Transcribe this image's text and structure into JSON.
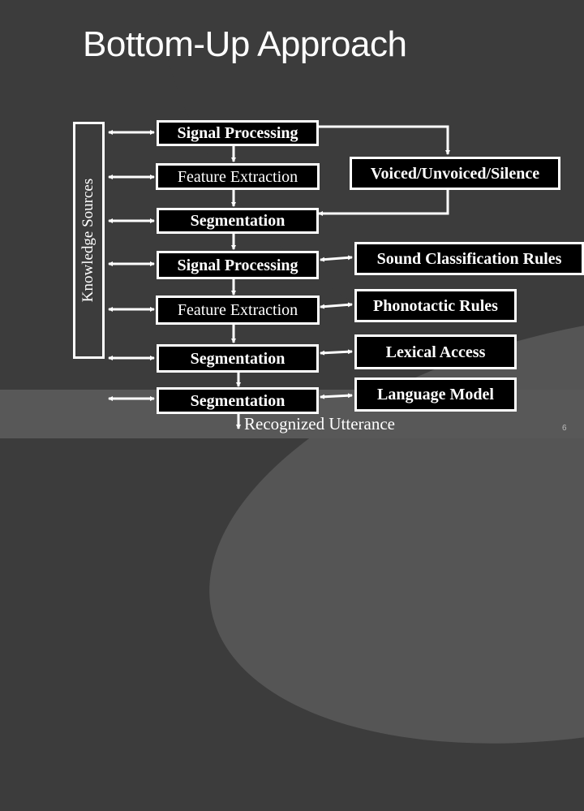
{
  "slide": {
    "title": "Bottom-Up Approach",
    "page_number": "6"
  },
  "diagram": {
    "knowledge_sources_label": "Knowledge Sources",
    "pipeline": [
      "Signal Processing",
      "Feature Extraction",
      "Segmentation",
      "Signal Processing",
      "Feature Extraction",
      "Segmentation",
      "Segmentation"
    ],
    "side_boxes": [
      "Voiced/Unvoiced/Silence",
      "Sound Classification Rules",
      "Phonotactic Rules",
      "Lexical Access",
      "Language Model"
    ],
    "output_label": "Recognized Utterance",
    "colors": {
      "background": "#3c3c3c",
      "box_fill": "#000000",
      "line": "#ffffff"
    }
  }
}
